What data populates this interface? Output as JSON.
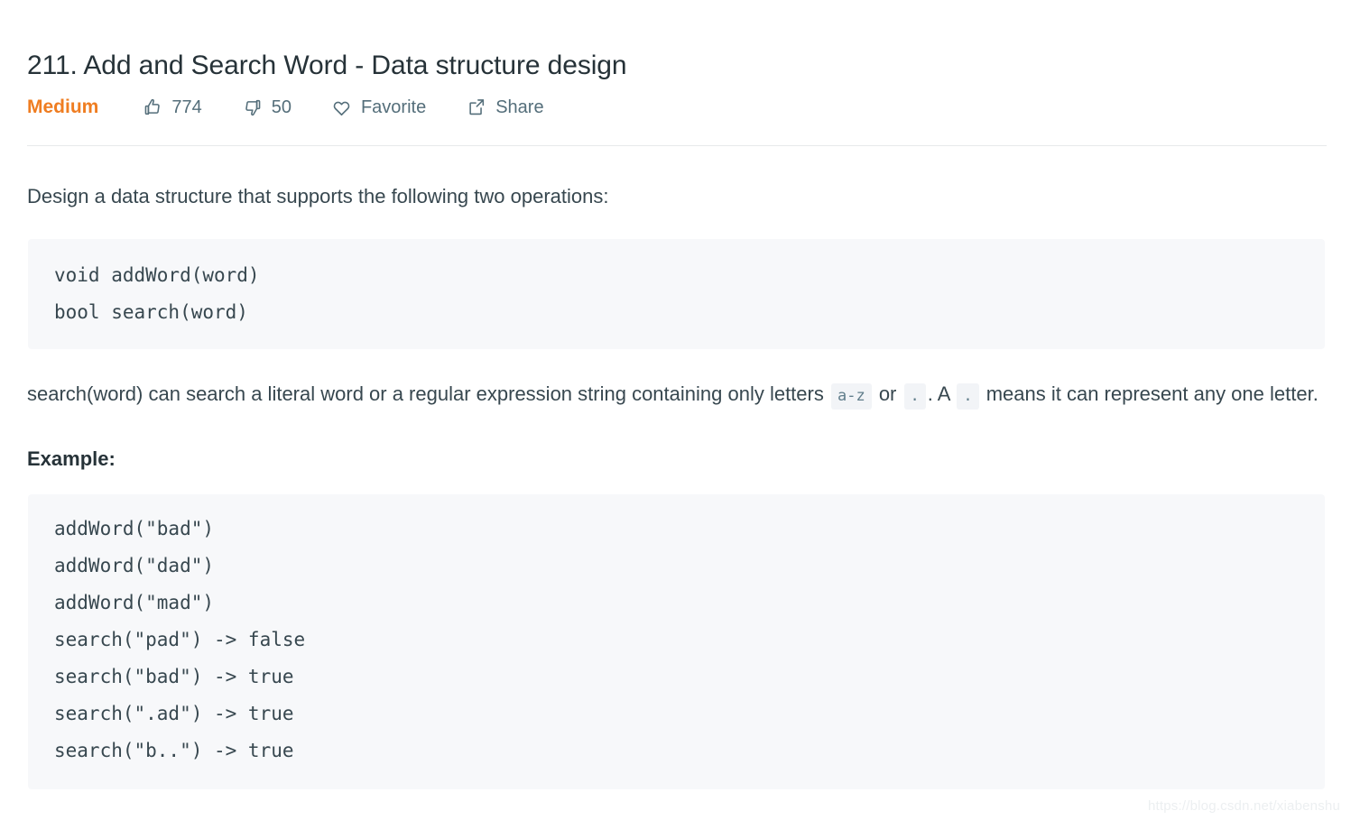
{
  "problem": {
    "title": "211. Add and Search Word - Data structure design"
  },
  "action_bar": {
    "difficulty": "Medium",
    "difficulty_color": "#ef7d21",
    "items": [
      {
        "icon": "thumbs-up-icon",
        "label": "774"
      },
      {
        "icon": "thumbs-down-icon",
        "label": "50"
      },
      {
        "icon": "heart-icon",
        "label": "Favorite"
      },
      {
        "icon": "share-icon",
        "label": "Share"
      }
    ]
  },
  "content": {
    "intro_paragraph": "Design a data structure that supports the following two operations:",
    "signature_code": [
      "void addWord(word)",
      "bool search(word)"
    ],
    "search_paragraph": {
      "part1": "search(word) can search a literal word or a regular expression string containing only letters ",
      "code1": "a-z",
      "part2": " or ",
      "code2": ".",
      "part3": ". A ",
      "code3": ".",
      "part4": " means it can represent any one letter."
    },
    "example_heading": "Example:",
    "example_code": [
      "addWord(\"bad\")",
      "addWord(\"dad\")",
      "addWord(\"mad\")",
      "search(\"pad\") -> false",
      "search(\"bad\") -> true",
      "search(\".ad\") -> true",
      "search(\"b..\") -> true"
    ]
  },
  "watermark": {
    "text": "https://blog.csdn.net/xiabenshu"
  }
}
